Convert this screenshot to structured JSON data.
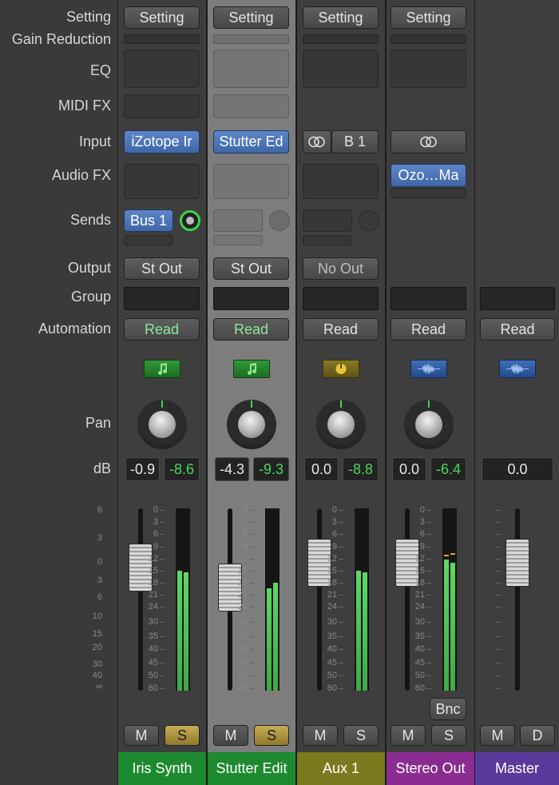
{
  "labels": {
    "setting": "Setting",
    "gain_reduction": "Gain Reduction",
    "eq": "EQ",
    "midi_fx": "MIDI FX",
    "input": "Input",
    "audio_fx": "Audio FX",
    "sends": "Sends",
    "output": "Output",
    "group": "Group",
    "automation": "Automation",
    "pan": "Pan",
    "db": "dB"
  },
  "scale_left": [
    "6",
    "3",
    "0",
    "3",
    "6",
    "10",
    "15",
    "20",
    "30",
    "40",
    "∞"
  ],
  "scale_meter": [
    "0",
    "3",
    "6",
    "9",
    "12",
    "15",
    "18",
    "21",
    "24",
    "30",
    "35",
    "40",
    "45",
    "50",
    "60"
  ],
  "colors": {
    "iris": "#1e8a2f",
    "stutter": "#1e8a2f",
    "aux": "#7c7a1f",
    "stereo": "#8a2c91",
    "master": "#5a3a9a"
  },
  "strips": [
    {
      "name": "Iris Synth",
      "setting": "Setting",
      "input": "iZotope Ir",
      "send": "Bus 1",
      "output": "St Out",
      "automation": "Read",
      "icon": "music-note-icon",
      "db_fader": "-0.9",
      "db_peak": "-8.6",
      "mute": "M",
      "solo": "S",
      "fader_db": 0.9,
      "meter_level": [
        0.66,
        0.65
      ]
    },
    {
      "name": "Stutter Edit",
      "setting": "Setting",
      "input": "Stutter Ed",
      "output": "St Out",
      "automation": "Read",
      "icon": "music-note-icon",
      "db_fader": "-4.3",
      "db_peak": "-9.3",
      "mute": "M",
      "solo": "S",
      "fader_db": 4.3,
      "meter_level": [
        0.56,
        0.59
      ]
    },
    {
      "name": "Aux 1",
      "setting": "Setting",
      "input": "B 1",
      "output": "No Out",
      "automation": "Read",
      "icon": "aux-knob-icon",
      "db_fader": "0.0",
      "db_peak": "-8.8",
      "mute": "M",
      "solo": "S",
      "fader_db": 0,
      "meter_level": [
        0.66,
        0.65
      ]
    },
    {
      "name": "Stereo Out",
      "setting": "Setting",
      "audio_fx": "Ozo…Ma",
      "output_bnc": "Bnc",
      "automation": "Read",
      "icon": "waveform-icon",
      "db_fader": "0.0",
      "db_peak": "-6.4",
      "mute": "M",
      "solo": "S",
      "fader_db": 0,
      "meter_level": [
        0.72,
        0.7
      ]
    },
    {
      "name": "Master",
      "automation": "Read",
      "icon": "waveform-icon",
      "db_fader": "0.0",
      "mute": "M",
      "dim": "D",
      "fader_db": 0
    }
  ]
}
